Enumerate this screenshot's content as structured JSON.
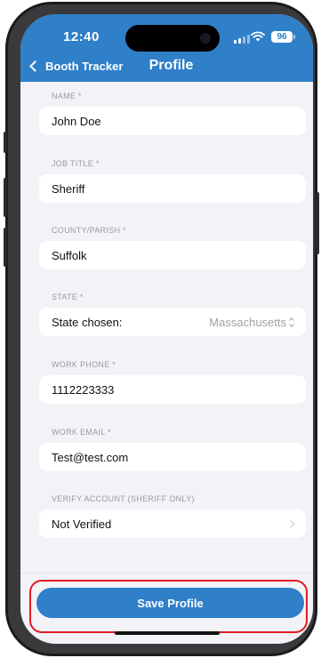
{
  "status_bar": {
    "time": "12:40",
    "battery": "96"
  },
  "nav": {
    "back_label": "Booth Tracker",
    "title": "Profile"
  },
  "form": {
    "name": {
      "label": "NAME *",
      "value": "John Doe"
    },
    "job_title": {
      "label": "JOB TITLE *",
      "value": "Sheriff"
    },
    "county": {
      "label": "COUNTY/PARISH *",
      "value": "Suffolk"
    },
    "state": {
      "label": "STATE *",
      "prefix": "State chosen:",
      "value": "Massachusetts"
    },
    "work_phone": {
      "label": "WORK PHONE *",
      "value": "1112223333"
    },
    "work_email": {
      "label": "WORK EMAIL *",
      "value": "Test@test.com"
    },
    "verify": {
      "label": "VERIFY ACCOUNT (SHERIFF ONLY)",
      "value": "Not Verified"
    }
  },
  "actions": {
    "save_label": "Save Profile"
  },
  "colors": {
    "accent": "#2f7fc9",
    "highlight": "#e31b23"
  }
}
